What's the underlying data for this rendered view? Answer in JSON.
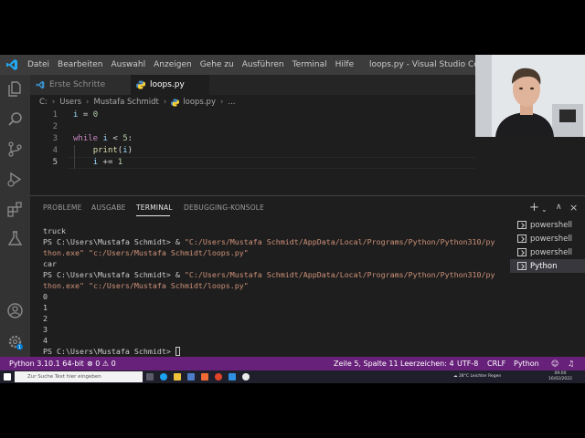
{
  "window": {
    "title": "loops.py - Visual Studio Code"
  },
  "menu": [
    "Datei",
    "Bearbeiten",
    "Auswahl",
    "Anzeigen",
    "Gehe zu",
    "Ausführen",
    "Terminal",
    "Hilfe"
  ],
  "tabs": [
    {
      "label": "Erste Schritte"
    },
    {
      "label": "loops.py"
    }
  ],
  "breadcrumb": [
    "C:",
    "Users",
    "Mustafa Schmidt",
    "loops.py",
    "..."
  ],
  "editor": {
    "line_numbers": [
      "1",
      "2",
      "3",
      "4",
      "5"
    ],
    "lines": [
      {
        "tokens": [
          {
            "t": "i",
            "c": "var"
          },
          {
            "t": " = ",
            "c": "op"
          },
          {
            "t": "0",
            "c": "num"
          }
        ]
      },
      {
        "tokens": []
      },
      {
        "tokens": [
          {
            "t": "while",
            "c": "kw"
          },
          {
            "t": " ",
            "c": "op"
          },
          {
            "t": "i",
            "c": "var"
          },
          {
            "t": " < ",
            "c": "op"
          },
          {
            "t": "5",
            "c": "num"
          },
          {
            "t": ":",
            "c": "op"
          }
        ]
      },
      {
        "tokens": [
          {
            "t": "    ",
            "c": "op"
          },
          {
            "t": "print",
            "c": "fn"
          },
          {
            "t": "(",
            "c": "op"
          },
          {
            "t": "i",
            "c": "var"
          },
          {
            "t": ")",
            "c": "op"
          }
        ]
      },
      {
        "tokens": [
          {
            "t": "    ",
            "c": "op"
          },
          {
            "t": "i",
            "c": "var"
          },
          {
            "t": " += ",
            "c": "op"
          },
          {
            "t": "1",
            "c": "num"
          }
        ]
      }
    ]
  },
  "panel": {
    "tabs": [
      "PROBLEME",
      "AUSGABE",
      "TERMINAL",
      "DEBUGGING-KONSOLE"
    ],
    "active_tab": "TERMINAL",
    "terminal_lines": [
      [
        {
          "t": "truck",
          "c": ""
        }
      ],
      [
        {
          "t": "PS C:\\Users\\Mustafa Schmidt> & ",
          "c": ""
        },
        {
          "t": "\"C:/Users/Mustafa Schmidt/AppData/Local/Programs/Python/Python310/py",
          "c": "str"
        }
      ],
      [
        {
          "t": "thon.exe\" \"c:/Users/Mustafa Schmidt/loops.py\"",
          "c": "str"
        }
      ],
      [
        {
          "t": "car",
          "c": ""
        }
      ],
      [
        {
          "t": "PS C:\\Users\\Mustafa Schmidt> & ",
          "c": ""
        },
        {
          "t": "\"C:/Users/Mustafa Schmidt/AppData/Local/Programs/Python/Python310/py",
          "c": "str"
        }
      ],
      [
        {
          "t": "thon.exe\" \"c:/Users/Mustafa Schmidt/loops.py\"",
          "c": "str"
        }
      ],
      [
        {
          "t": "0",
          "c": ""
        }
      ],
      [
        {
          "t": "1",
          "c": ""
        }
      ],
      [
        {
          "t": "2",
          "c": ""
        }
      ],
      [
        {
          "t": "3",
          "c": ""
        }
      ],
      [
        {
          "t": "4",
          "c": ""
        }
      ],
      [
        {
          "t": "PS C:\\Users\\Mustafa Schmidt> ",
          "c": ""
        }
      ]
    ],
    "terminals": [
      {
        "label": "powershell"
      },
      {
        "label": "powershell"
      },
      {
        "label": "powershell"
      },
      {
        "label": "Python"
      }
    ]
  },
  "statusbar": {
    "interpreter": "Python 3.10.1 64-bit",
    "errors": "0",
    "warnings": "0",
    "cursor_position": "Zeile 5, Spalte 11",
    "spaces": "Leerzeichen: 4",
    "encoding": "UTF-8",
    "eol": "CRLF",
    "language": "Python"
  },
  "taskbar": {
    "search_placeholder": "Zur Suche Text hier eingeben",
    "weather": "28°C Leichter Regen",
    "time": "09:00",
    "date": "16/02/2022"
  },
  "colors": {
    "statusbar": "#68217a",
    "activitybar": "#333333",
    "editor_bg": "#1e1e1e",
    "accent_string": "#ce9178"
  },
  "icons": [
    "vscode-logo-icon",
    "explorer-icon",
    "search-icon",
    "source-control-icon",
    "run-debug-icon",
    "extensions-icon",
    "testing-icon",
    "account-icon",
    "settings-icon",
    "python-file-icon",
    "terminal-icon"
  ]
}
